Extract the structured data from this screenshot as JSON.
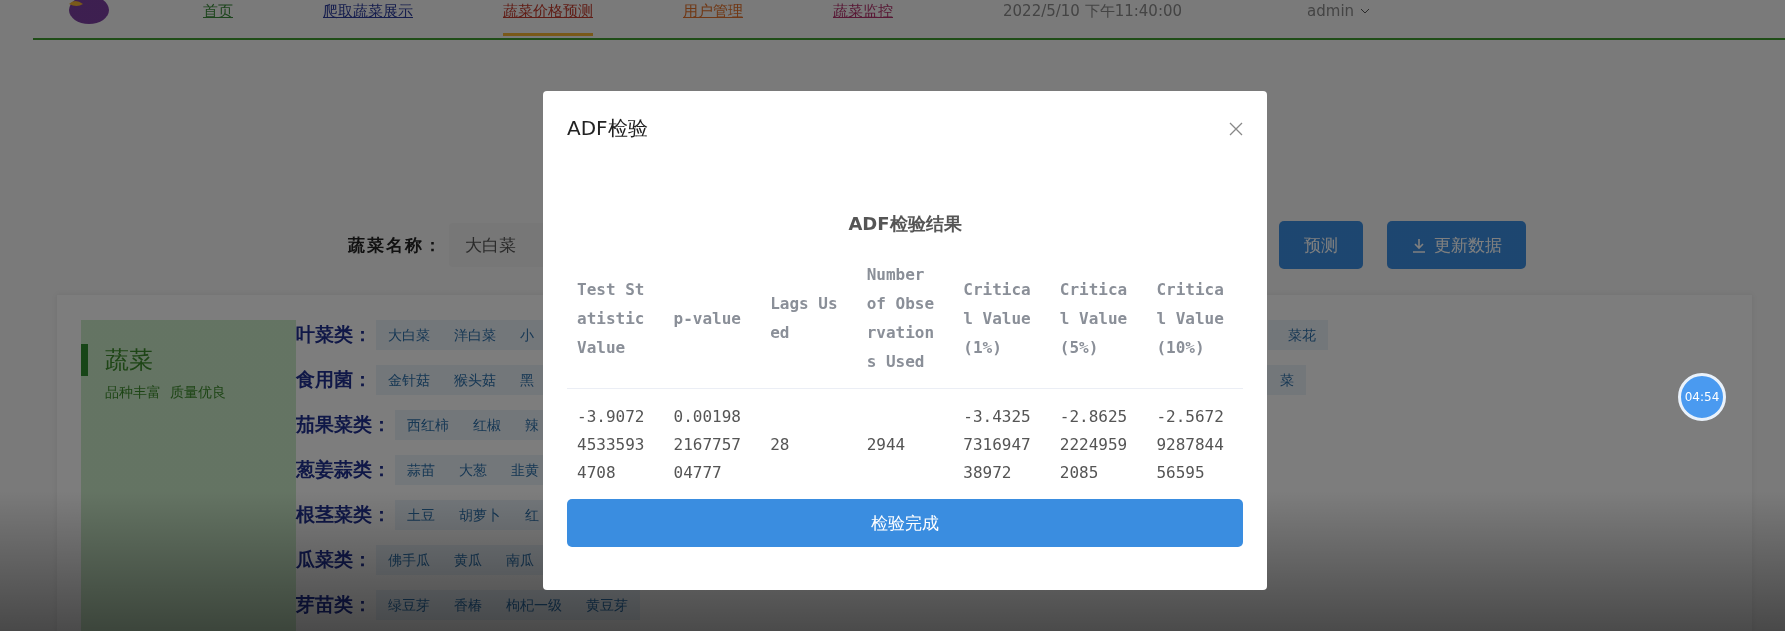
{
  "nav": {
    "items": [
      {
        "label": "首页",
        "selected": false
      },
      {
        "label": "爬取蔬菜展示",
        "selected": false
      },
      {
        "label": "蔬菜价格预测",
        "selected": true
      },
      {
        "label": "用户管理",
        "selected": false
      },
      {
        "label": "蔬菜监控",
        "selected": false
      }
    ],
    "datetime": "2022/5/10 下午11:40:00",
    "user": "admin"
  },
  "search": {
    "label": "蔬菜名称：",
    "value": "大白菜"
  },
  "buttons": [
    {
      "label": "预测",
      "kind": "plain"
    },
    {
      "label": "更新数据",
      "kind": "download"
    }
  ],
  "category_panel": {
    "title": "蔬菜",
    "subtitle": "品种丰富  质量优良"
  },
  "categories": [
    {
      "label": "叶菜类：",
      "tags": [
        "大白菜",
        "洋白菜",
        "小"
      ],
      "right_tags": [
        "菜花"
      ]
    },
    {
      "label": "食用菌：",
      "tags": [
        "金针菇",
        "猴头菇",
        "黑"
      ],
      "right_tags": [
        "菜"
      ]
    },
    {
      "label": "茄果菜类：",
      "tags": [
        "西红柿",
        "红椒",
        "辣"
      ]
    },
    {
      "label": "葱姜蒜类：",
      "tags": [
        "蒜苗",
        "大葱",
        "韭黄"
      ]
    },
    {
      "label": "根茎菜类：",
      "tags": [
        "土豆",
        "胡萝卜",
        "红"
      ]
    },
    {
      "label": "瓜菜类：",
      "tags": [
        "佛手瓜",
        "黄瓜",
        "南瓜"
      ]
    },
    {
      "label": "芽苗类：",
      "tags": [
        "绿豆芽",
        "香椿",
        "枸杞一级",
        "黄豆芽"
      ]
    }
  ],
  "modal": {
    "title": "ADF检验",
    "heading": "ADF检验结果",
    "columns": [
      "Test Statistic Value",
      "p-value",
      "Lags Used",
      "Number of Observations Used",
      "Critical Value (1%)",
      "Critical Value (5%)",
      "Critical Value (10%)"
    ],
    "rows": [
      [
        "-3.907245335934708",
        "0.00198216775704777",
        "28",
        "2944",
        "-3.4325731694738972",
        "-2.862522249592085",
        "-2.5672928784456595"
      ]
    ],
    "button": "检验完成"
  },
  "timer": "04:54"
}
